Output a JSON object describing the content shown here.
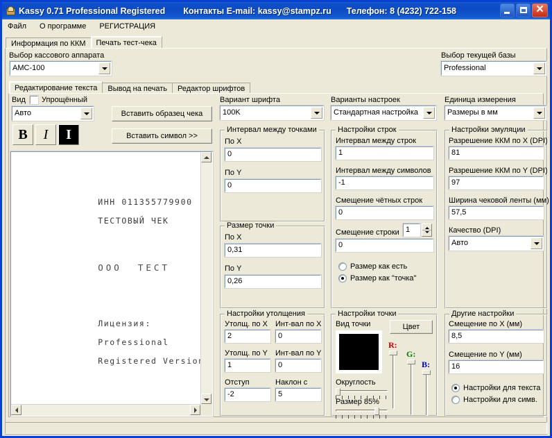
{
  "window": {
    "title_app": "Kassy 0.71 Professional Registered",
    "title_contacts": "Контакты E-mail: kassy@stampz.ru",
    "title_phone": "Телефон: 8 (4232) 722-158",
    "icon": "app-icon",
    "buttons": {
      "minimize": "minimize-button",
      "maximize": "maximize-button",
      "close": "close-button"
    }
  },
  "menu": {
    "items": [
      "Файл",
      "О программе",
      "РЕГИСТРАЦИЯ"
    ]
  },
  "main_tabs": {
    "items": [
      "Информация по ККМ",
      "Печать тест-чека"
    ],
    "active_index": 1
  },
  "device": {
    "label": "Выбор кассового аппарата",
    "value": "АМС-100"
  },
  "database": {
    "label": "Выбор текущей базы",
    "value": "Professional"
  },
  "sub_tabs": {
    "items": [
      "Редактирование текста",
      "Вывод на печать",
      "Редактор шрифтов"
    ],
    "active_index": 0
  },
  "view": {
    "label": "Вид",
    "checkbox_label": "Упрощённый",
    "checkbox_checked": false,
    "mode_value": "Авто"
  },
  "format_buttons": {
    "bold": "B",
    "italic": "I",
    "invert": "I"
  },
  "actions": {
    "insert_sample": "Вставить образец чека",
    "insert_symbol": "Вставить символ >>"
  },
  "editor": {
    "lines": [
      "ИНН 011355779900",
      "ТЕСТОВЫЙ ЧЕК"
    ],
    "big_line": "ООО  ТЕСТ",
    "lines2": [
      "Лицензия:",
      "Professional",
      "Registered Version"
    ]
  },
  "font_variant": {
    "label": "Вариант шрифта",
    "value": "100K"
  },
  "settings_variant": {
    "label": "Варианты настроек",
    "value": "Стандартная настройка"
  },
  "unit": {
    "label": "Единица измерения",
    "value": "Размеры в мм"
  },
  "dot_interval": {
    "title": "Интервал между точками",
    "x_label": "По X",
    "x_value": "0",
    "y_label": "По Y",
    "y_value": "0"
  },
  "dot_size": {
    "title": "Размер точки",
    "x_label": "По X",
    "x_value": "0,31",
    "y_label": "По Y",
    "y_value": "0,26"
  },
  "line_settings": {
    "title": "Настройки строк",
    "line_interval_label": "Интервал между строк",
    "line_interval_value": "1",
    "char_interval_label": "Интервал между символов",
    "char_interval_value": "-1",
    "even_offset_label": "Смещение чётных строк",
    "even_offset_value": "0",
    "row_offset_label": "Смещение строки",
    "row_offset_spin": "1",
    "row_offset_value": "0",
    "radio_as_is": "Размер как есть",
    "radio_as_dot": "Размер как \"точка\"",
    "radio_selected": "as_dot"
  },
  "emulation": {
    "title": "Настройки эмуляции",
    "dpi_x_label": "Разрешение ККМ по X (DPI)",
    "dpi_x_value": "81",
    "dpi_y_label": "Разрешение ККМ по Y (DPI)",
    "dpi_y_value": "97",
    "tape_label": "Ширина чековой ленты (мм)",
    "tape_value": "57,5",
    "quality_label": "Качество (DPI)",
    "quality_value": "Авто"
  },
  "thickening": {
    "title": "Настройки утолщения",
    "thick_x_label": "Утолщ. по X",
    "thick_x_value": "2",
    "int_x_label": "Инт-вал по X",
    "int_x_value": "0",
    "thick_y_label": "Утолщ. по Y",
    "thick_y_value": "1",
    "int_y_label": "Инт-вал по Y",
    "int_y_value": "0",
    "indent_label": "Отступ",
    "indent_value": "-2",
    "slope_label": "Наклон с",
    "slope_value": "5"
  },
  "dot_settings": {
    "title": "Настройки точки",
    "preview_label": "Вид точки",
    "color_button": "Цвет",
    "swatch_color": "#000000",
    "r_label": "R:",
    "g_label": "G:",
    "b_label": "B:",
    "r_color": "#cc0000",
    "g_color": "#008000",
    "b_color": "#0000cc",
    "roundness_label": "Округлость",
    "size_label": "Размер 85%"
  },
  "other_settings": {
    "title": "Другие настройки",
    "offset_x_label": "Смещение по X (мм)",
    "offset_x_value": "8,5",
    "offset_y_label": "Смещение по Y (мм)",
    "offset_y_value": "16",
    "radio_text": "Настройки для текста",
    "radio_symbol": "Настройки для симв.",
    "radio_selected": "text"
  }
}
